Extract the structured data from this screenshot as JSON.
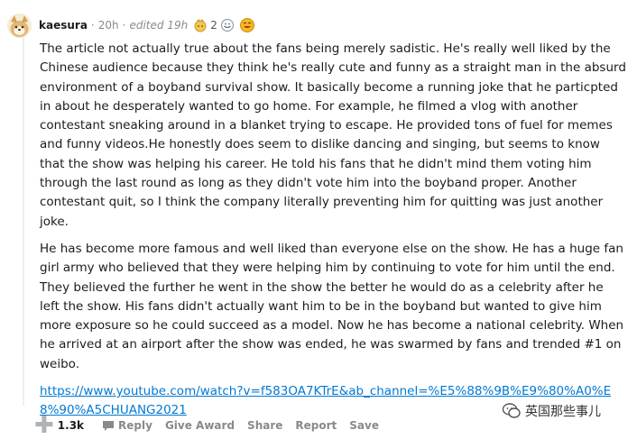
{
  "comment": {
    "username": "kaesura",
    "time": "20h",
    "edited": "edited 19h",
    "awards": [
      {
        "icon": "silver-award-icon",
        "color": "#e5b54a"
      },
      {
        "icon": "comment-award-icon",
        "color": "#8fa3b0",
        "count": "2"
      },
      {
        "icon": "laughing-award-icon",
        "color": "#e8a41c"
      }
    ],
    "paragraphs": [
      "The article not actually true about the fans being merely sadistic. He's really well liked by the Chinese audience because they think he's really cute and funny as a straight man in the absurd environment of a boyband survival show. It basically become a running joke that he particpted in about he desperately wanted to go home. For example, he filmed a vlog with another contestant sneaking around in a blanket trying to escape. He provided tons of fuel for memes and funny videos.He honestly does seem to dislike dancing and singing, but seems to know that the show was helping his career. He told his fans that he didn't mind them voting him through the last round as long as they didn't vote him into the boyband proper. Another contestant quit, so I think the company literally preventing him for quitting was just another joke.",
      "He has become more famous and well liked than everyone else on the show. He has a huge fan girl army who believed that they were helping him by continuing to vote for him until the end. They believed the further he went in the show the better he would do as a celebrity after he left the show. His fans didn't actually want him to be in the boyband but wanted to give him more exposure so he could succeed as a model. Now he has become a national celebrity. When he arrived at an airport after the show was ended, he was swarmed by fans and trended #1 on weibo."
    ],
    "link": "https://www.youtube.com/watch?v=f583OA7KTrE&ab_channel=%E5%88%9B%E9%80%A0%E8%90%A5CHUANG2021"
  },
  "actions": {
    "score": "1.3k",
    "reply": "Reply",
    "give_award": "Give Award",
    "share": "Share",
    "report": "Report",
    "save": "Save"
  },
  "watermark": {
    "text": "英国那些事儿"
  },
  "colors": {
    "link": "#0079d3",
    "meta": "#878a8c",
    "text": "#1c1c1c"
  }
}
